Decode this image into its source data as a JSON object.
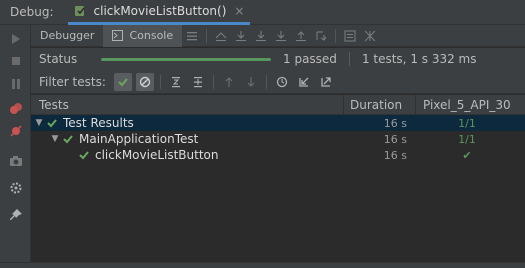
{
  "titlebar": {
    "label": "Debug:",
    "tab_title": "clickMovieListButton()",
    "close": "×"
  },
  "subtabs": {
    "debugger": "Debugger",
    "console": "Console"
  },
  "status": {
    "label": "Status",
    "progress": 1.0,
    "passed": "1 passed",
    "summary": "1 tests, 1 s 332 ms"
  },
  "filter": {
    "label": "Filter tests:"
  },
  "table": {
    "headers": {
      "tests": "Tests",
      "duration": "Duration",
      "device": "Pixel_5_API_30"
    },
    "rows": [
      {
        "name": "Test Results",
        "duration": "16 s",
        "device": "1/1"
      },
      {
        "name": "MainApplicationTest",
        "duration": "16 s",
        "device": "1/1"
      },
      {
        "name": "clickMovieListButton",
        "duration": "16 s",
        "device": "✔"
      }
    ]
  },
  "colors": {
    "accent": "#4a88c7",
    "pass": "#57965c",
    "selected": "#0d293e"
  }
}
